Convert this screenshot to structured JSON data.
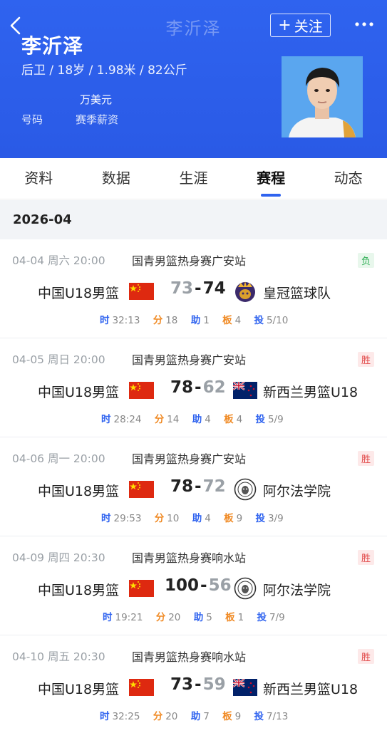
{
  "header": {
    "title_faded": "李沂泽",
    "follow_label": "关注",
    "player_name": "李沂泽",
    "player_info": "后卫 / 18岁 / 1.98米 / 82公斤",
    "salary_value": "万美元",
    "number_label": "号码",
    "salary_label": "赛季薪资"
  },
  "tabs": [
    "资料",
    "数据",
    "生涯",
    "赛程",
    "动态"
  ],
  "active_tab": "赛程",
  "month": "2026-04",
  "stat_keys": {
    "time": "时",
    "points": "分",
    "assists": "助",
    "rebounds": "板",
    "fg": "投"
  },
  "colors": {
    "header_blue": "#2f63ef",
    "win": "#e04343",
    "loss": "#2fae55",
    "orange": "#f08a24"
  },
  "games": [
    {
      "date": "04-04  周六 20:00",
      "event": "国青男篮热身赛广安站",
      "result": "负",
      "result_type": "loss",
      "home_team": "中国U18男篮",
      "home_score": "73",
      "away_score": "74",
      "away_team": "皇冠篮球队",
      "away_logo": "crown-logo-icon",
      "time": "32:13",
      "points": "18",
      "assists": "1",
      "rebounds": "4",
      "fg": "5/10"
    },
    {
      "date": "04-05  周日 20:00",
      "event": "国青男篮热身赛广安站",
      "result": "胜",
      "result_type": "win",
      "home_team": "中国U18男篮",
      "home_score": "78",
      "away_score": "62",
      "away_team": "新西兰男篮U18",
      "away_logo": "nz-flag-icon",
      "time": "28:24",
      "points": "14",
      "assists": "4",
      "rebounds": "4",
      "fg": "5/9"
    },
    {
      "date": "04-06  周一 20:00",
      "event": "国青男篮热身赛广安站",
      "result": "胜",
      "result_type": "win",
      "home_team": "中国U18男篮",
      "home_score": "78",
      "away_score": "72",
      "away_team": "阿尔法学院",
      "away_logo": "alpha-academy-logo-icon",
      "time": "29:53",
      "points": "10",
      "assists": "4",
      "rebounds": "9",
      "fg": "3/9"
    },
    {
      "date": "04-09  周四 20:30",
      "event": "国青男篮热身赛响水站",
      "result": "胜",
      "result_type": "win",
      "home_team": "中国U18男篮",
      "home_score": "100",
      "away_score": "56",
      "away_team": "阿尔法学院",
      "away_logo": "alpha-academy-logo-icon",
      "time": "19:21",
      "points": "20",
      "assists": "5",
      "rebounds": "1",
      "fg": "7/9"
    },
    {
      "date": "04-10  周五 20:30",
      "event": "国青男篮热身赛响水站",
      "result": "胜",
      "result_type": "win",
      "home_team": "中国U18男篮",
      "home_score": "73",
      "away_score": "59",
      "away_team": "新西兰男篮U18",
      "away_logo": "nz-flag-icon",
      "time": "32:25",
      "points": "20",
      "assists": "7",
      "rebounds": "9",
      "fg": "7/13"
    }
  ]
}
